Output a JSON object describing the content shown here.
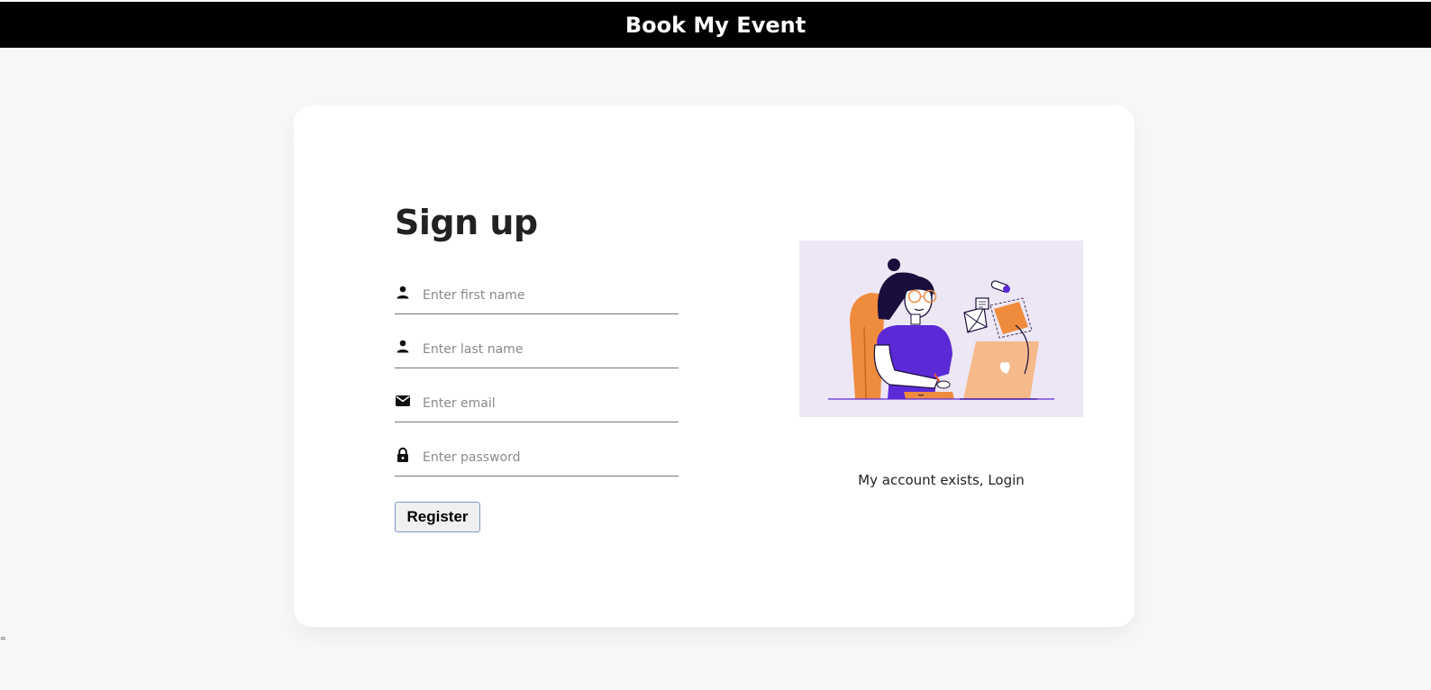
{
  "header": {
    "title": "Book My Event"
  },
  "form": {
    "heading": "Sign up",
    "fields": [
      {
        "icon": "person-icon",
        "placeholder": "Enter first name",
        "value": ""
      },
      {
        "icon": "person-icon",
        "placeholder": "Enter last name",
        "value": ""
      },
      {
        "icon": "envelope-icon",
        "placeholder": "Enter email",
        "value": ""
      },
      {
        "icon": "lock-icon",
        "placeholder": "Enter password",
        "value": ""
      }
    ],
    "register_label": "Register"
  },
  "side": {
    "login_link": "My account exists, Login"
  },
  "colors": {
    "header_bg": "#000000",
    "page_bg": "#f8f8f8",
    "illustration_bg": "#ede6f4",
    "illustration_purple": "#5b2ad6",
    "illustration_orange": "#ee8b3d"
  },
  "misc": {
    "edge_mark": "="
  }
}
